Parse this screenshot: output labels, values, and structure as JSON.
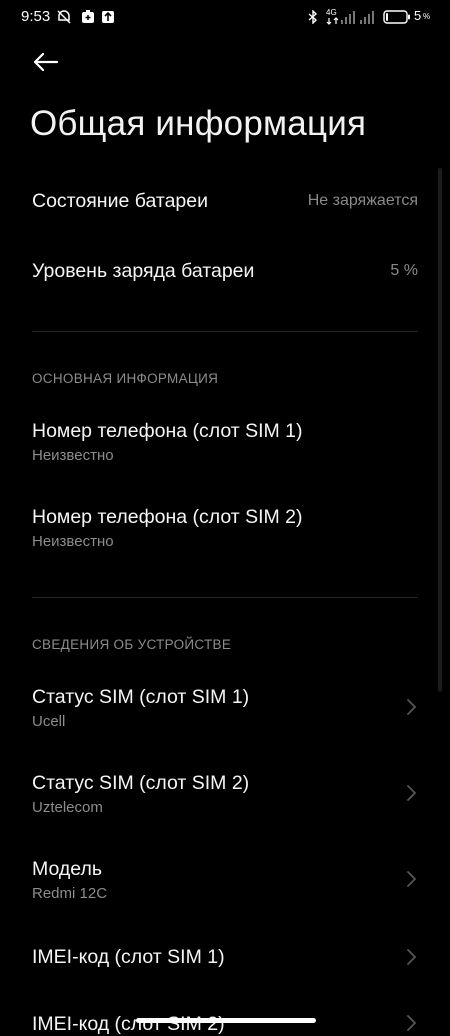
{
  "status_bar": {
    "time": "9:53",
    "network": "4G",
    "battery_percent": "5",
    "battery_suffix": "%"
  },
  "header": {
    "title": "Общая информация",
    "back_icon": "arrow-left-icon"
  },
  "battery": {
    "state_label": "Состояние батареи",
    "state_value": "Не заряжается",
    "level_label": "Уровень заряда батареи",
    "level_value": "5 %"
  },
  "basic_info": {
    "header": "ОСНОВНАЯ ИНФОРМАЦИЯ",
    "items": [
      {
        "title": "Номер телефона (слот SIM 1)",
        "subtitle": "Неизвестно"
      },
      {
        "title": "Номер телефона (слот SIM 2)",
        "subtitle": "Неизвестно"
      }
    ]
  },
  "device_info": {
    "header": "СВЕДЕНИЯ ОБ УСТРОЙСТВЕ",
    "items": [
      {
        "title": "Статус SIM (слот SIM 1)",
        "subtitle": "Ucell"
      },
      {
        "title": "Статус SIM (слот SIM 2)",
        "subtitle": "Uztelecom"
      },
      {
        "title": "Модель",
        "subtitle": "Redmi 12C"
      },
      {
        "title": "IMEI-код (слот SIM 1)",
        "subtitle": ""
      },
      {
        "title": "IMEI-код (слот SIM 2)",
        "subtitle": ""
      }
    ]
  },
  "colors": {
    "background": "#000000",
    "primary_text": "#f5f5f5",
    "secondary_text": "#8c8c8c",
    "divider": "#262626"
  }
}
